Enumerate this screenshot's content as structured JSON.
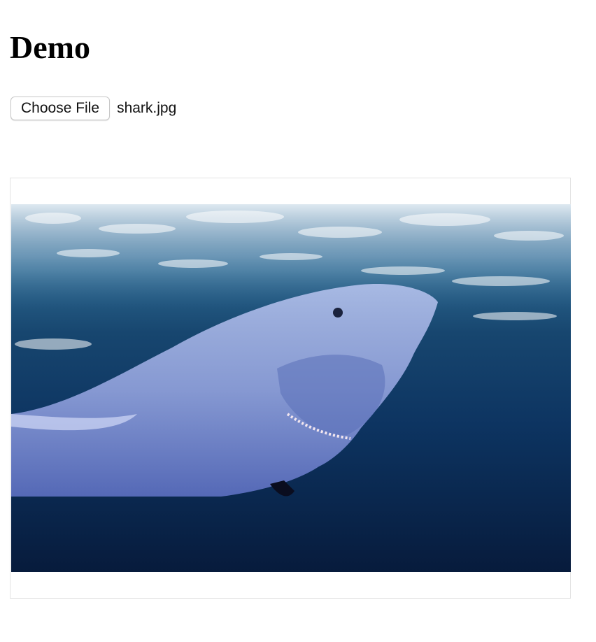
{
  "page": {
    "title": "Demo"
  },
  "file_input": {
    "button_label": "Choose File",
    "file_name": "shark.jpg"
  },
  "preview": {
    "subject": "great white shark underwater with semi-transparent blue segmentation mask over the shark"
  }
}
